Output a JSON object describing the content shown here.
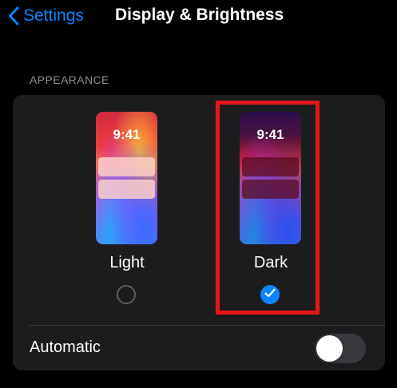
{
  "navbar": {
    "back_label": "Settings",
    "back_icon": "chevron-left-icon",
    "title": "Display & Brightness"
  },
  "appearance": {
    "section_header": "APPEARANCE",
    "options": [
      {
        "label": "Light",
        "time": "9:41",
        "selected": false
      },
      {
        "label": "Dark",
        "time": "9:41",
        "selected": true
      }
    ],
    "selected_icon": "checkmark-icon",
    "highlight_color": "#e3161b"
  },
  "automatic": {
    "label": "Automatic",
    "enabled": false
  },
  "colors": {
    "accent": "#0a84ff",
    "background": "#000000",
    "card": "#1c1c1e",
    "secondary_text": "#8d8d93"
  }
}
